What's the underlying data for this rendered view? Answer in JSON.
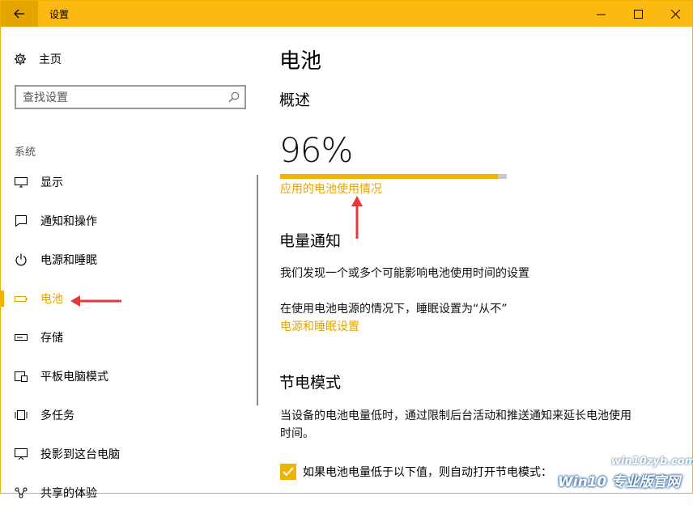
{
  "window": {
    "title": "设置"
  },
  "sidebar": {
    "home_label": "主页",
    "search_placeholder": "查找设置",
    "section_label": "系统",
    "items": [
      {
        "label": "显示",
        "icon": "display-icon"
      },
      {
        "label": "通知和操作",
        "icon": "notification-icon"
      },
      {
        "label": "电源和睡眠",
        "icon": "power-icon"
      },
      {
        "label": "电池",
        "icon": "battery-icon",
        "active": true
      },
      {
        "label": "存储",
        "icon": "storage-icon"
      },
      {
        "label": "平板电脑模式",
        "icon": "tablet-icon"
      },
      {
        "label": "多任务",
        "icon": "multitask-icon"
      },
      {
        "label": "投影到这台电脑",
        "icon": "project-icon"
      },
      {
        "label": "共享的体验",
        "icon": "share-icon"
      }
    ]
  },
  "main": {
    "title": "电池",
    "overview": {
      "heading": "概述",
      "percent_text": "96%",
      "percent_value": 0.96,
      "usage_link": "应用的电池使用情况"
    },
    "notifications": {
      "heading": "电量通知",
      "text": "我们发现一个或多个可能影响电池使用时间的设置",
      "detail": "在使用电池电源的情况下，睡眠设置为“从不”",
      "link": "电源和睡眠设置"
    },
    "saver": {
      "heading": "节电模式",
      "description": "当设备的电池电量低时，通过限制后台活动和推送通知来延长电池使用时间。",
      "checkbox_label": "如果电池电量低于以下值，则自动打开节电模式：",
      "checked": true
    }
  },
  "watermark": {
    "url": "win10zyb.com",
    "text": "Win10 专业版官网"
  },
  "colors": {
    "accent": "#fbb911",
    "link": "#e6a400",
    "arrow": "#e23a3a"
  }
}
